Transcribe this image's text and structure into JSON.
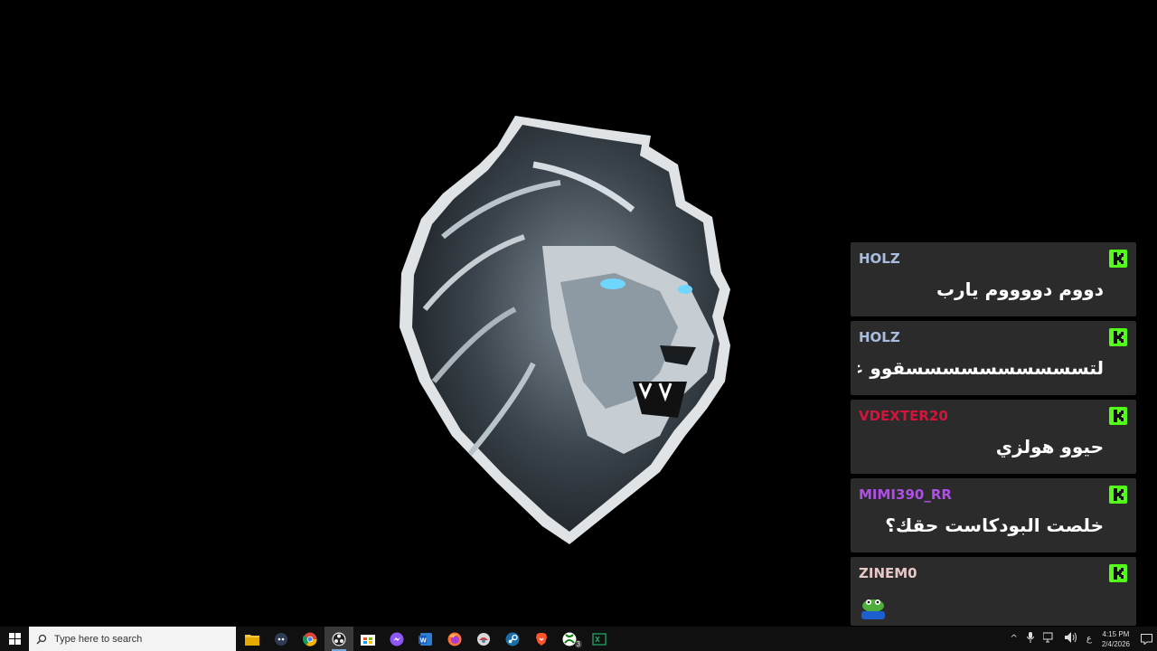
{
  "chat": {
    "messages": [
      {
        "user": "HOLZ",
        "user_color": "#a9bde0",
        "text": "دووم دووووم يارب"
      },
      {
        "user": "HOLZ",
        "user_color": "#a9bde0",
        "text": "لتسسسسسسسسسسقوو عاشو"
      },
      {
        "user": "VDEXTER20",
        "user_color": "#d4143c",
        "text": "حيوو هولزي"
      },
      {
        "user": "MIMI390_RR",
        "user_color": "#b04fe8",
        "text": "خلصت البودكاست حقك؟"
      },
      {
        "user": "ZINEM0",
        "user_color": "#e8c7c7",
        "text": "",
        "emote": "frog-emote"
      }
    ],
    "platform_icon": "kick-icon",
    "platform_color": "#53fc18"
  },
  "taskbar": {
    "search_placeholder": "Type here to search",
    "apps": [
      "file-explorer-icon",
      "discord-icon",
      "chrome-icon",
      "obs-icon",
      "store-icon",
      "messenger-icon",
      "word-icon",
      "firefox-icon",
      "app-icon",
      "steam-icon",
      "brave-icon",
      "xbox-icon",
      "excel-icon"
    ],
    "xbox_badge": "3",
    "language": "ع",
    "time": "4:15 PM",
    "date": "2/4/2026"
  }
}
